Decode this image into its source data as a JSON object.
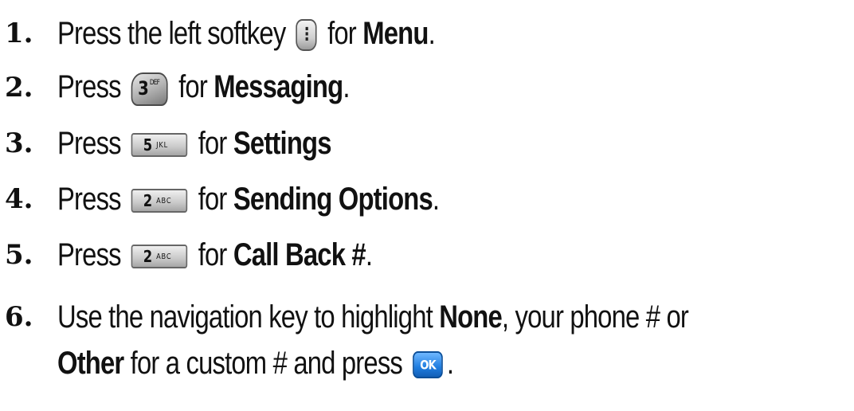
{
  "steps": [
    {
      "num": "1.",
      "before": "Press the left softkey",
      "key": {
        "type": "softkey",
        "icon": "vertical-dots-icon",
        "glyph": "⋮"
      },
      "mid": "for",
      "bold": "Menu",
      "after": "."
    },
    {
      "num": "2.",
      "before": "Press",
      "key": {
        "type": "round",
        "digit": "3",
        "letters": "DEF"
      },
      "mid": "for",
      "bold": "Messaging",
      "after": "."
    },
    {
      "num": "3.",
      "before": "Press",
      "key": {
        "type": "flat",
        "digit": "5",
        "letters": "JKL"
      },
      "mid": "for",
      "bold": "Settings",
      "after": ""
    },
    {
      "num": "4.",
      "before": "Press",
      "key": {
        "type": "flat",
        "digit": "2",
        "letters": "ABC"
      },
      "mid": "for",
      "bold": "Sending Options",
      "after": "."
    },
    {
      "num": "5.",
      "before": "Press",
      "key": {
        "type": "flat",
        "digit": "2",
        "letters": "ABC"
      },
      "mid": "for",
      "bold": "Call Back #",
      "after": "."
    }
  ],
  "step6": {
    "num": "6.",
    "line1_before": "Use the navigation key to highlight",
    "line1_bold": "None",
    "line1_after": ", your phone # or",
    "line2_bold": "Other",
    "line2_mid": "for a custom # and press",
    "ok_label": "OK",
    "line2_after": "."
  }
}
